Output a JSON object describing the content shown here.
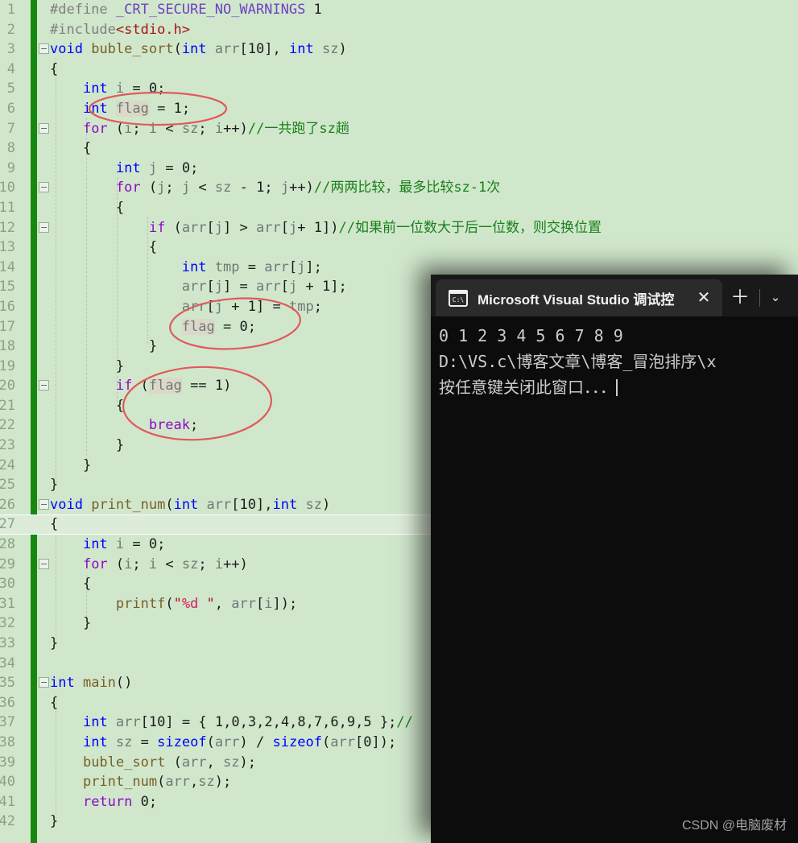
{
  "editor": {
    "background_color": "#d0e7cc",
    "change_bar_color": "#16880f",
    "current_line": 27,
    "lines": [
      {
        "n": 1,
        "fold": "",
        "text": "#define _CRT_SECURE_NO_WARNINGS 1"
      },
      {
        "n": 2,
        "fold": "",
        "text": "#include<stdio.h>"
      },
      {
        "n": 3,
        "fold": "open",
        "text": "void buble_sort(int arr[10], int sz)"
      },
      {
        "n": 4,
        "fold": "",
        "text": "{"
      },
      {
        "n": 5,
        "fold": "",
        "text": "    int i = 0;"
      },
      {
        "n": 6,
        "fold": "",
        "text": "    int flag = 1;"
      },
      {
        "n": 7,
        "fold": "open",
        "text": "    for (i; i < sz; i++)//一共跑了sz趟"
      },
      {
        "n": 8,
        "fold": "",
        "text": "    {"
      },
      {
        "n": 9,
        "fold": "",
        "text": "        int j = 0;"
      },
      {
        "n": 10,
        "fold": "open",
        "text": "        for (j; j < sz - 1; j++)//两两比较，最多比较sz-1次"
      },
      {
        "n": 11,
        "fold": "",
        "text": "        {"
      },
      {
        "n": 12,
        "fold": "open",
        "text": "            if (arr[j] > arr[j+ 1])//如果前一位数大于后一位数，则交换位置"
      },
      {
        "n": 13,
        "fold": "",
        "text": "            {"
      },
      {
        "n": 14,
        "fold": "",
        "text": "                int tmp = arr[j];"
      },
      {
        "n": 15,
        "fold": "",
        "text": "                arr[j] = arr[j + 1];"
      },
      {
        "n": 16,
        "fold": "",
        "text": "                arr[j + 1] = tmp;"
      },
      {
        "n": 17,
        "fold": "",
        "text": "                flag = 0;"
      },
      {
        "n": 18,
        "fold": "",
        "text": "            }"
      },
      {
        "n": 19,
        "fold": "",
        "text": "        }"
      },
      {
        "n": 20,
        "fold": "open",
        "text": "        if (flag == 1)"
      },
      {
        "n": 21,
        "fold": "",
        "text": "        {"
      },
      {
        "n": 22,
        "fold": "",
        "text": "            break;"
      },
      {
        "n": 23,
        "fold": "",
        "text": "        }"
      },
      {
        "n": 24,
        "fold": "",
        "text": "    }"
      },
      {
        "n": 25,
        "fold": "",
        "text": "}"
      },
      {
        "n": 26,
        "fold": "open",
        "text": "void print_num(int arr[10],int sz)"
      },
      {
        "n": 27,
        "fold": "",
        "text": "{"
      },
      {
        "n": 28,
        "fold": "",
        "text": "    int i = 0;"
      },
      {
        "n": 29,
        "fold": "open",
        "text": "    for (i; i < sz; i++)"
      },
      {
        "n": 30,
        "fold": "",
        "text": "    {"
      },
      {
        "n": 31,
        "fold": "",
        "text": "        printf(\"%d \", arr[i]);"
      },
      {
        "n": 32,
        "fold": "",
        "text": "    }"
      },
      {
        "n": 33,
        "fold": "",
        "text": "}"
      },
      {
        "n": 34,
        "fold": "",
        "text": ""
      },
      {
        "n": 35,
        "fold": "open",
        "text": "int main()"
      },
      {
        "n": 36,
        "fold": "",
        "text": "{"
      },
      {
        "n": 37,
        "fold": "",
        "text": "    int arr[10] = { 1,0,3,2,4,8,7,6,9,5 };//"
      },
      {
        "n": 38,
        "fold": "",
        "text": "    int sz = sizeof(arr) / sizeof(arr[0]);"
      },
      {
        "n": 39,
        "fold": "",
        "text": "    buble_sort (arr, sz);"
      },
      {
        "n": 40,
        "fold": "",
        "text": "    print_num(arr,sz);"
      },
      {
        "n": 41,
        "fold": "",
        "text": "    return 0;"
      },
      {
        "n": 42,
        "fold": "",
        "text": "}"
      }
    ],
    "annotations": [
      {
        "id": "ellipse-flag-declaration",
        "target": "int flag = 1;",
        "color": "#e05a5a"
      },
      {
        "id": "ellipse-flag-reset",
        "target": "flag = 0;",
        "color": "#e05a5a"
      },
      {
        "id": "ellipse-flag-check",
        "target": "if (flag == 1) { break; }",
        "color": "#e05a5a"
      }
    ]
  },
  "console": {
    "tab": {
      "icon": "cmd-prompt-icon",
      "icon_text": "C:\\",
      "title": "Microsoft Visual Studio 调试控",
      "close_label": "✕"
    },
    "new_tab_label": "＋",
    "dropdown_label": "⌄",
    "output": [
      "0 1 2 3 4 5 6 7 8 9 ",
      "D:\\VS.c\\博客文章\\博客_冒泡排序\\x",
      "按任意键关闭此窗口．．．"
    ],
    "background_color": "#0c0c0c",
    "text_color": "#cccccc"
  },
  "watermark": {
    "text": "CSDN @电脑废材"
  }
}
